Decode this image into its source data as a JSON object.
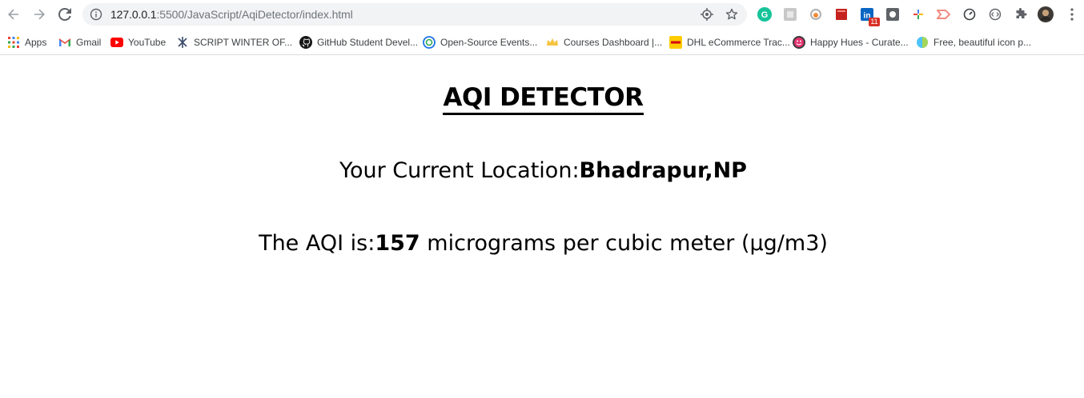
{
  "browser": {
    "url_host": "127.0.0.1",
    "url_path": ":5500/JavaScript/AqiDetector/index.html",
    "extension_badge": "11"
  },
  "bookmarks": [
    {
      "label": "Apps",
      "icon": "apps-grid-icon"
    },
    {
      "label": "Gmail",
      "icon": "gmail-icon"
    },
    {
      "label": "YouTube",
      "icon": "youtube-icon"
    },
    {
      "label": "SCRIPT WINTER OF...",
      "icon": "script-winter-icon"
    },
    {
      "label": "GitHub Student Devel...",
      "icon": "github-icon"
    },
    {
      "label": "Open-Source Events...",
      "icon": "open-source-icon"
    },
    {
      "label": "Courses Dashboard |...",
      "icon": "crown-icon"
    },
    {
      "label": "DHL eCommerce Trac...",
      "icon": "dhl-icon"
    },
    {
      "label": "Happy Hues - Curate...",
      "icon": "happy-hues-icon"
    },
    {
      "label": "Free, beautiful icon p...",
      "icon": "globe-icon"
    }
  ],
  "page": {
    "title": "AQI DETECTOR",
    "location_label": "Your Current Location:",
    "location_value": "Bhadrapur,NP",
    "aqi_label": "The AQI is:",
    "aqi_value": "157",
    "aqi_unit": " micrograms per cubic meter (µg/m3)"
  },
  "colors": {
    "chrome_icon": "#5f6368",
    "omnibox_bg": "#f1f3f4",
    "youtube_red": "#ff0000",
    "badge_red": "#d93025"
  }
}
